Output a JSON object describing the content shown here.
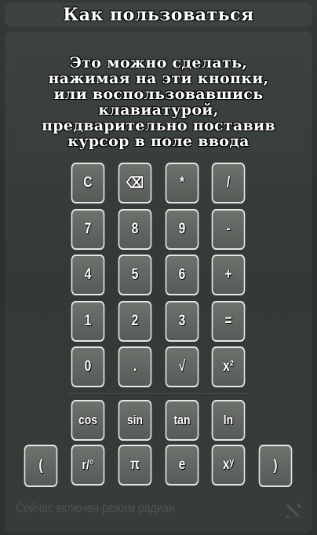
{
  "title": "Как пользоваться",
  "instructions": [
    "Это можно сделать,",
    "нажимая на эти кнопки,",
    "или воспользовавшись",
    "клавиатурой,",
    "предварительно поставив",
    "курсор в поле ввода"
  ],
  "keypad": {
    "row1": [
      "C",
      "⌫",
      "*",
      "/"
    ],
    "row2": [
      "7",
      "8",
      "9",
      "-"
    ],
    "row3": [
      "4",
      "5",
      "6",
      "+"
    ],
    "row4": [
      "1",
      "2",
      "3",
      "="
    ],
    "row5": [
      "0",
      ".",
      "√",
      "x²"
    ],
    "func_row": [
      "cos",
      "sin",
      "tan",
      "ln"
    ],
    "bottom_row": [
      "(",
      "r/°",
      "π",
      "e",
      "xʸ",
      ")"
    ]
  },
  "footer": {
    "mode_text": "Сейчас включен режим радиан",
    "icon": "tools-icon"
  },
  "colors": {
    "background": "#2d332f",
    "key_fill": "#5f645f",
    "key_border": "#e6e6e6",
    "footer_text": "#4d5450"
  }
}
